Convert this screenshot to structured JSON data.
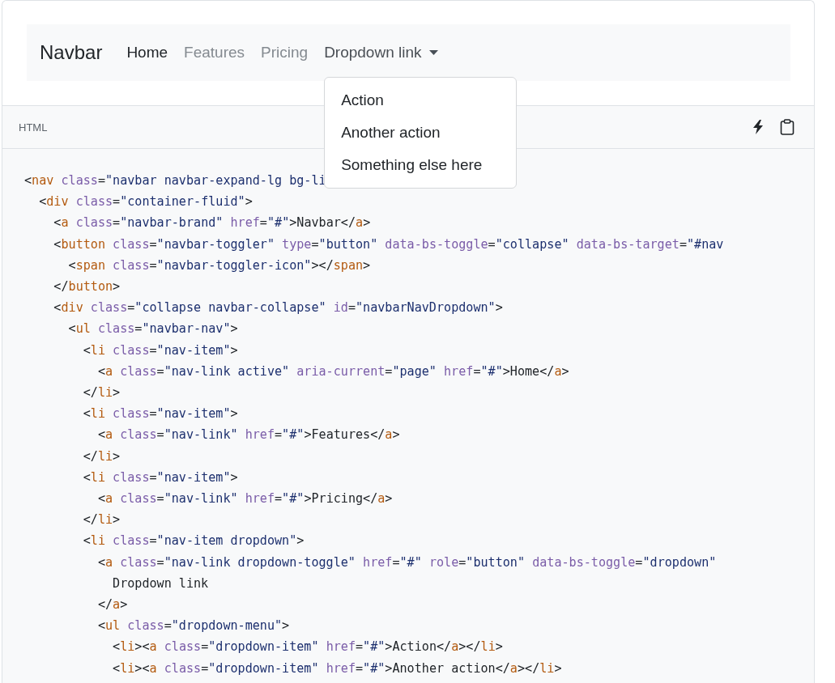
{
  "navbar": {
    "brand": "Navbar",
    "items": [
      {
        "label": "Home",
        "kind": "link",
        "selected": true
      },
      {
        "label": "Features",
        "kind": "link",
        "selected": false
      },
      {
        "label": "Pricing",
        "kind": "link",
        "selected": false
      },
      {
        "label": "Dropdown link",
        "kind": "dropdown",
        "selected": false,
        "expanded": true,
        "menu": [
          "Action",
          "Another action",
          "Something else here"
        ]
      }
    ]
  },
  "code_header": {
    "language": "HTML"
  },
  "code_lines": [
    "<nav class=\"navbar navbar-expand-lg bg-li",
    "  <div class=\"container-fluid\">",
    "    <a class=\"navbar-brand\" href=\"#\">Navbar</a>",
    "    <button class=\"navbar-toggler\" type=\"button\" data-bs-toggle=\"collapse\" data-bs-target=\"#nav",
    "      <span class=\"navbar-toggler-icon\"></span>",
    "    </button>",
    "    <div class=\"collapse navbar-collapse\" id=\"navbarNavDropdown\">",
    "      <ul class=\"navbar-nav\">",
    "        <li class=\"nav-item\">",
    "          <a class=\"nav-link active\" aria-current=\"page\" href=\"#\">Home</a>",
    "        </li>",
    "        <li class=\"nav-item\">",
    "          <a class=\"nav-link\" href=\"#\">Features</a>",
    "        </li>",
    "        <li class=\"nav-item\">",
    "          <a class=\"nav-link\" href=\"#\">Pricing</a>",
    "        </li>",
    "        <li class=\"nav-item dropdown\">",
    "          <a class=\"nav-link dropdown-toggle\" href=\"#\" role=\"button\" data-bs-toggle=\"dropdown\"",
    "            Dropdown link",
    "          </a>",
    "          <ul class=\"dropdown-menu\">",
    "            <li><a class=\"dropdown-item\" href=\"#\">Action</a></li>",
    "            <li><a class=\"dropdown-item\" href=\"#\">Another action</a></li>"
  ]
}
